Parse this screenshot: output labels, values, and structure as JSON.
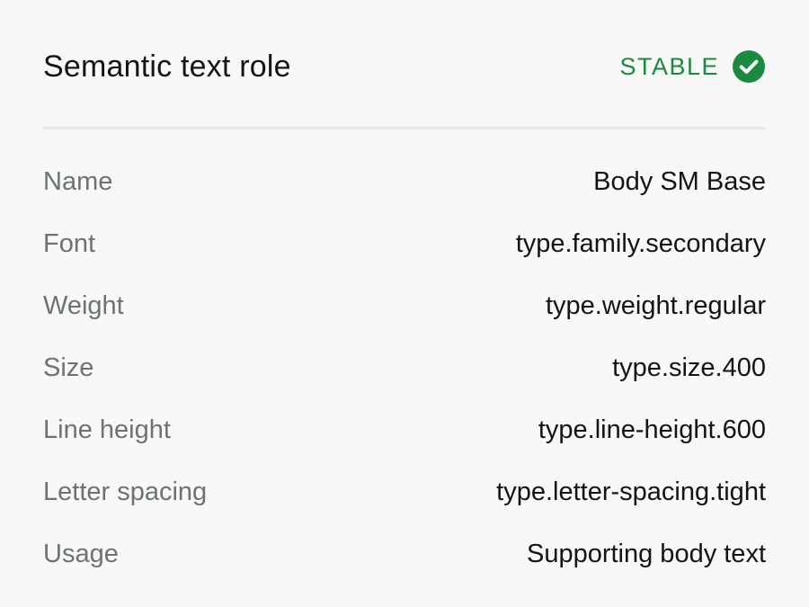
{
  "panel": {
    "title": "Semantic text role",
    "status": {
      "label": "STABLE",
      "color": "#1c8a3e",
      "icon": "check-circle-icon"
    },
    "properties": [
      {
        "label": "Name",
        "value": "Body SM Base"
      },
      {
        "label": "Font",
        "value": "type.family.secondary"
      },
      {
        "label": "Weight",
        "value": "type.weight.regular"
      },
      {
        "label": "Size",
        "value": "type.size.400"
      },
      {
        "label": "Line height",
        "value": "type.line-height.600"
      },
      {
        "label": "Letter spacing",
        "value": "type.letter-spacing.tight"
      },
      {
        "label": "Usage",
        "value": "Supporting body text"
      }
    ]
  }
}
